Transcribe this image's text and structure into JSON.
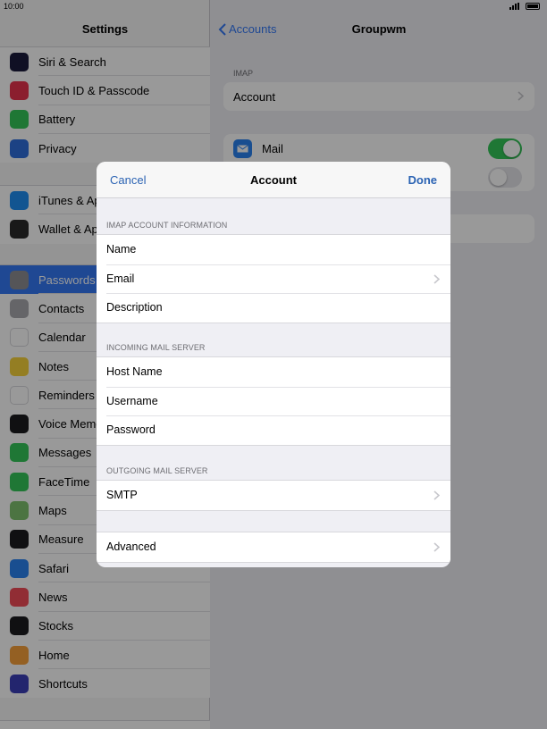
{
  "status": {
    "time": "10:00"
  },
  "sidebar": {
    "title": "Settings",
    "group1": [
      {
        "label": "Siri & Search",
        "icon": "siri-icon",
        "color": "#1c1c3c"
      },
      {
        "label": "Touch ID & Passcode",
        "icon": "fingerprint-icon",
        "color": "#e8324d"
      },
      {
        "label": "Battery",
        "icon": "battery-icon",
        "color": "#34c759"
      },
      {
        "label": "Privacy",
        "icon": "hand-icon",
        "color": "#2f6fdc"
      }
    ],
    "group2": [
      {
        "label": "iTunes & Ap",
        "icon": "app-store-icon",
        "color": "#1f8ef2"
      },
      {
        "label": "Wallet & Ap",
        "icon": "wallet-icon",
        "color": "#2b2b2b"
      }
    ],
    "group3": [
      {
        "label": "Passwords",
        "icon": "key-icon",
        "color": "#8e8e93",
        "selected": true
      },
      {
        "label": "Contacts",
        "icon": "contacts-icon",
        "color": "#a8a8ad"
      },
      {
        "label": "Calendar",
        "icon": "calendar-icon",
        "color": "#ffffff"
      },
      {
        "label": "Notes",
        "icon": "notes-icon",
        "color": "#f7d23b"
      },
      {
        "label": "Reminders",
        "icon": "reminders-icon",
        "color": "#ffffff"
      },
      {
        "label": "Voice Memo",
        "icon": "voice-memo-icon",
        "color": "#1c1c1e"
      },
      {
        "label": "Messages",
        "icon": "messages-icon",
        "color": "#34c759"
      },
      {
        "label": "FaceTime",
        "icon": "facetime-icon",
        "color": "#34c759"
      },
      {
        "label": "Maps",
        "icon": "maps-icon",
        "color": "#7fc16f"
      },
      {
        "label": "Measure",
        "icon": "measure-icon",
        "color": "#1c1c1e"
      },
      {
        "label": "Safari",
        "icon": "safari-icon",
        "color": "#2a83f0"
      },
      {
        "label": "News",
        "icon": "news-icon",
        "color": "#f24b58"
      },
      {
        "label": "Stocks",
        "icon": "stocks-icon",
        "color": "#1c1c1e"
      },
      {
        "label": "Home",
        "icon": "home-icon",
        "color": "#f7a03b"
      },
      {
        "label": "Shortcuts",
        "icon": "shortcuts-icon",
        "color": "#3b3fb8"
      }
    ]
  },
  "detail": {
    "back_label": "Accounts",
    "title": "Groupwm",
    "imap_header": "IMAP",
    "account_label": "Account",
    "mail_label": "Mail",
    "mail_on": true,
    "second_toggle_on": false
  },
  "modal": {
    "cancel": "Cancel",
    "title": "Account",
    "done": "Done",
    "sections": [
      {
        "header": "IMAP ACCOUNT INFORMATION",
        "rows": [
          {
            "label": "Name",
            "chevron": false
          },
          {
            "label": "Email",
            "chevron": true
          },
          {
            "label": "Description",
            "chevron": false
          }
        ]
      },
      {
        "header": "INCOMING MAIL SERVER",
        "rows": [
          {
            "label": "Host Name",
            "chevron": false
          },
          {
            "label": "Username",
            "chevron": false
          },
          {
            "label": "Password",
            "chevron": false
          }
        ]
      },
      {
        "header": "OUTGOING MAIL SERVER",
        "rows": [
          {
            "label": "SMTP",
            "chevron": true
          }
        ]
      },
      {
        "header": "",
        "rows": [
          {
            "label": "Advanced",
            "chevron": true
          }
        ]
      }
    ]
  },
  "colors": {
    "accent": "#3478f6",
    "toggle_on": "#34c759",
    "toggle_off": "#e5e5ea"
  }
}
